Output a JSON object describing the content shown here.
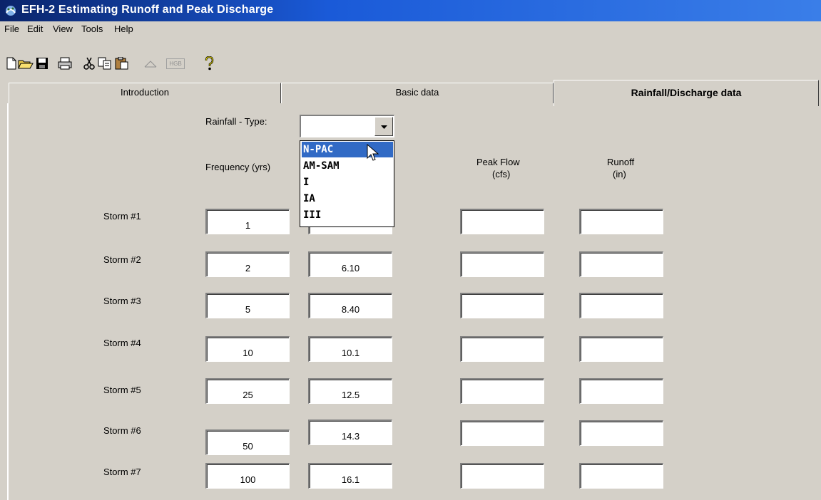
{
  "window": {
    "title": "EFH-2  Estimating Runoff and Peak Discharge"
  },
  "menu": [
    "File",
    "Edit",
    "View",
    "Tools",
    "Help"
  ],
  "toolbar": {
    "hgs_label": "HGB"
  },
  "tabs": [
    {
      "label": "Introduction",
      "active": false
    },
    {
      "label": "Basic data",
      "active": false
    },
    {
      "label": "Rainfall/Discharge data",
      "active": true
    }
  ],
  "form": {
    "rainfall_type_label": "Rainfall - Type:",
    "rainfall_type_value": "",
    "frequency_header": "Frequency (yrs)",
    "peak_flow_header": [
      "Peak Flow",
      "(cfs)"
    ],
    "runoff_header": [
      "Runoff",
      "(in)"
    ]
  },
  "dropdown": {
    "options": [
      "N-PAC",
      "AM-SAM",
      "I",
      "IA",
      "III"
    ],
    "highlighted_index": 0
  },
  "storms": [
    {
      "label": "Storm #1",
      "frequency": "1",
      "rainfall": "",
      "peak_flow": "",
      "runoff": ""
    },
    {
      "label": "Storm #2",
      "frequency": "2",
      "rainfall": "6.10",
      "peak_flow": "",
      "runoff": ""
    },
    {
      "label": "Storm #3",
      "frequency": "5",
      "rainfall": "8.40",
      "peak_flow": "",
      "runoff": ""
    },
    {
      "label": "Storm #4",
      "frequency": "10",
      "rainfall": "10.1",
      "peak_flow": "",
      "runoff": ""
    },
    {
      "label": "Storm #5",
      "frequency": "25",
      "rainfall": "12.5",
      "peak_flow": "",
      "runoff": ""
    },
    {
      "label": "Storm #6",
      "frequency": "50",
      "rainfall": "14.3",
      "peak_flow": "",
      "runoff": ""
    },
    {
      "label": "Storm #7",
      "frequency": "100",
      "rainfall": "16.1",
      "peak_flow": "",
      "runoff": ""
    }
  ],
  "icons": [
    "new-icon",
    "open-icon",
    "save-icon",
    "print-icon",
    "cut-icon",
    "copy-icon",
    "paste-icon",
    "graph-icon",
    "hgs-icon",
    "help-icon"
  ],
  "colors": {
    "titlebar": "#0a246a",
    "selection": "#316ac5",
    "face": "#d4d0c8"
  }
}
